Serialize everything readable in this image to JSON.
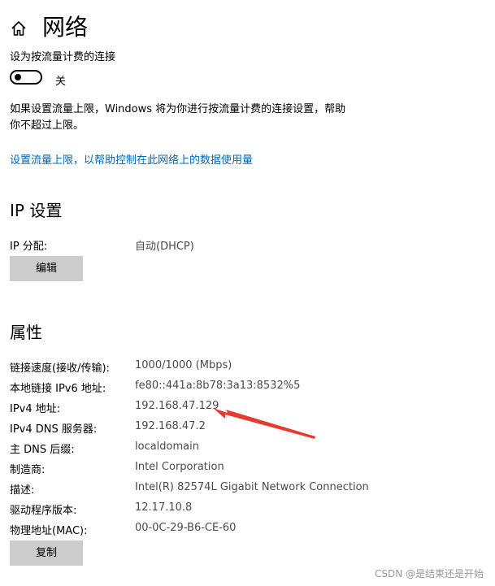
{
  "header": {
    "title": "网络",
    "home_icon": "home-icon"
  },
  "metered": {
    "label": "设为按流量计费的连接",
    "toggle_state": "关",
    "toggle_on": false,
    "info_line1": "如果设置流量上限，Windows 将为你进行按流量计费的连接设置，帮助",
    "info_line2": "你不超过上限。",
    "link": "设置流量上限，以帮助控制在此网络上的数据使用量"
  },
  "ip_settings": {
    "heading": "IP 设置",
    "assignment_label": "IP 分配:",
    "assignment_value": "自动(DHCP)",
    "edit_button": "编辑"
  },
  "properties": {
    "heading": "属性",
    "rows": [
      {
        "label": "链接速度(接收/传输):",
        "value": "1000/1000 (Mbps)"
      },
      {
        "label": "本地链接 IPv6 地址:",
        "value": "fe80::441a:8b78:3a13:8532%5"
      },
      {
        "label": "IPv4 地址:",
        "value": "192.168.47.129"
      },
      {
        "label": "IPv4 DNS 服务器:",
        "value": "192.168.47.2"
      },
      {
        "label": "主 DNS 后缀:",
        "value": "localdomain"
      },
      {
        "label": "制造商:",
        "value": "Intel Corporation"
      },
      {
        "label": "描述:",
        "value": "Intel(R) 82574L Gigabit Network Connection"
      },
      {
        "label": "驱动程序版本:",
        "value": "12.17.10.8"
      },
      {
        "label": "物理地址(MAC):",
        "value": "00-0C-29-B6-CE-60"
      }
    ],
    "copy_button": "复制"
  },
  "annotation": {
    "arrow_color": "#e8392f"
  },
  "watermark": "CSDN @是结束还是开始",
  "colors": {
    "link": "#0067b8",
    "button_bg": "#cccccc",
    "value_text": "#4a4a4a"
  }
}
